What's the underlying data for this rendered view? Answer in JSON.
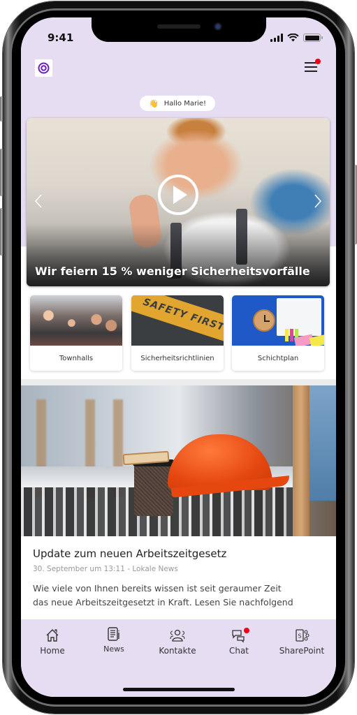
{
  "status_bar": {
    "time": "9:41",
    "icons": [
      "cellular-signal-icon",
      "wifi-icon",
      "battery-icon"
    ]
  },
  "header": {
    "logo_icon": "target-logo-icon",
    "menu_icon": "hamburger-menu-icon",
    "menu_has_notification": true
  },
  "greeting": {
    "emoji": "👋",
    "text": "Hallo Marie!"
  },
  "hero": {
    "title": "Wir feiern 15 % weniger Sicherheitsvorfälle",
    "play_icon": "play-icon",
    "prev_icon": "chevron-left-icon",
    "next_icon": "chevron-right-icon"
  },
  "tiles": [
    {
      "label": "Townhalls"
    },
    {
      "label": "Sicherheitsrichtlinien",
      "image_text": "SAFETY FIRST"
    },
    {
      "label": "Schichtplan"
    }
  ],
  "news": {
    "title": "Update zum neuen Arbeitszeitgesetz",
    "meta": "30. September um 13:11 - Lokale News",
    "excerpt_line1": "Wie viele von Ihnen bereits wissen ist seit geraumer Zeit",
    "excerpt_line2": "das neue Arbeitszeitgesetzt in Kraft. Lesen Sie nachfolgend"
  },
  "bottom_nav": [
    {
      "label": "Home",
      "icon": "home-icon",
      "badge": false
    },
    {
      "label": "News",
      "icon": "newspaper-icon",
      "badge": false
    },
    {
      "label": "Kontakte",
      "icon": "contacts-icon",
      "badge": false
    },
    {
      "label": "Chat",
      "icon": "chat-icon",
      "badge": true
    },
    {
      "label": "SharePoint",
      "icon": "sharepoint-icon",
      "badge": false
    }
  ],
  "colors": {
    "accent_lavender": "#e6ddf2",
    "logo_purple": "#6a1fc4",
    "notification_red": "#f00012"
  }
}
